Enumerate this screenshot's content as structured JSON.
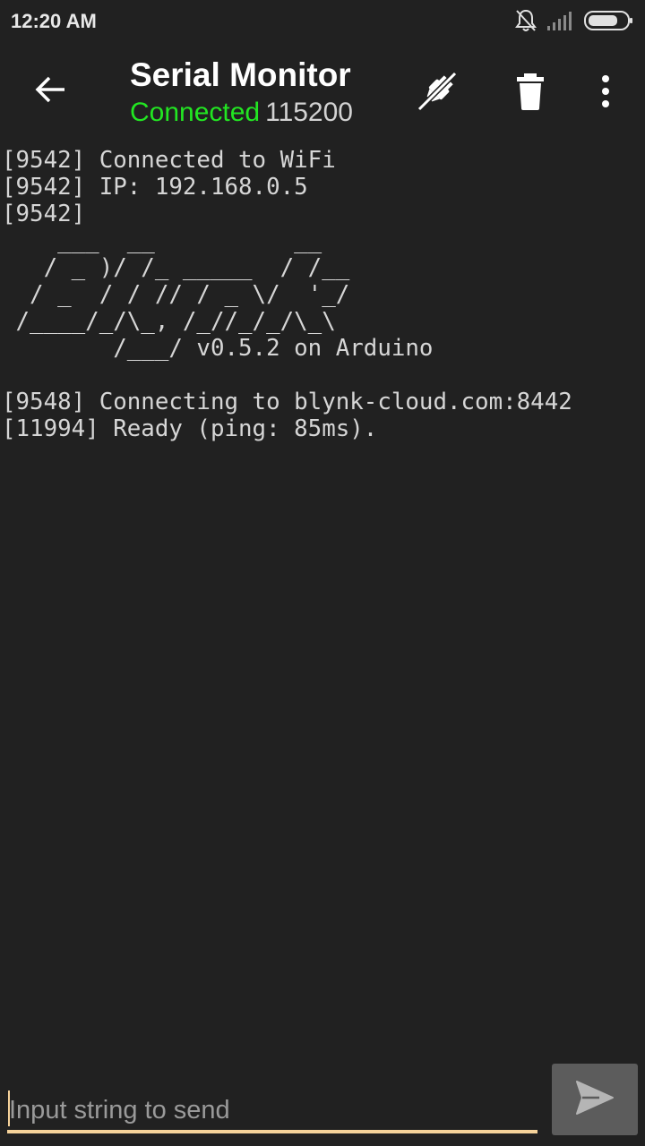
{
  "status_bar": {
    "time": "12:20 AM",
    "icons": [
      "notifications-off-icon",
      "signal-icon",
      "battery-icon"
    ]
  },
  "app_bar": {
    "title": "Serial Monitor",
    "connection_status": "Connected",
    "baud_rate": "115200",
    "icons": [
      "back-arrow-icon",
      "disconnect-plug-icon",
      "trash-icon",
      "more-vert-icon"
    ]
  },
  "terminal": {
    "lines": [
      "[9542] Connected to WiFi",
      "[9542] IP: 192.168.0.5",
      "[9542]",
      "    ___  __          __",
      "   / _ )/ /_ _____  / /__",
      "  / _  / / // / _ \\/  '_/",
      " /____/_/\\_, /_//_/_/\\_\\",
      "        /___/ v0.5.2 on Arduino",
      "",
      "[9548] Connecting to blynk-cloud.com:8442",
      "[11994] Ready (ping: 85ms)."
    ]
  },
  "input": {
    "placeholder": "Input string to send",
    "value": ""
  },
  "send_button": {
    "icon": "send-icon"
  },
  "colors": {
    "background": "#212121",
    "connected_green": "#22e622",
    "accent_underline": "#f5d29a",
    "send_button_bg": "#5c5c5c"
  }
}
